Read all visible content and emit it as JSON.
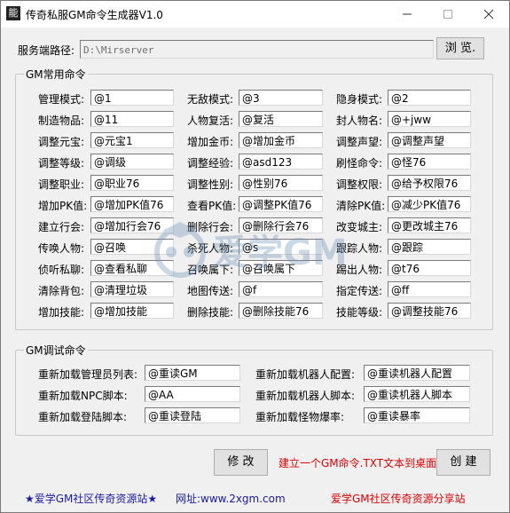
{
  "window": {
    "title": "传奇私服GM命令生成器V1.0",
    "app_icon_text": "能"
  },
  "server_path": {
    "label": "服务端路径:",
    "value": "D:\\Mirserver",
    "browse_label": "浏 览."
  },
  "common_group": {
    "title": "GM常用命令",
    "rows": [
      [
        {
          "label": "管理模式:",
          "value": "@1"
        },
        {
          "label": "无敌模式:",
          "value": "@3"
        },
        {
          "label": "隐身模式:",
          "value": "@2"
        }
      ],
      [
        {
          "label": "制造物品:",
          "value": "@11"
        },
        {
          "label": "人物复活:",
          "value": "@复活"
        },
        {
          "label": "封人物名:",
          "value": "@+jww"
        }
      ],
      [
        {
          "label": "调整元宝:",
          "value": "@元宝1"
        },
        {
          "label": "增加金币:",
          "value": "@增加金币"
        },
        {
          "label": "调整声望:",
          "value": "@调整声望"
        }
      ],
      [
        {
          "label": "调整等级:",
          "value": "@调级"
        },
        {
          "label": "调整经验:",
          "value": "@asd123"
        },
        {
          "label": "刷怪命令:",
          "value": "@怪76"
        }
      ],
      [
        {
          "label": "调整职业:",
          "value": "@职业76"
        },
        {
          "label": "调整性别:",
          "value": "@性别76"
        },
        {
          "label": "调整权限:",
          "value": "@给予权限76"
        }
      ],
      [
        {
          "label": "增加PK值:",
          "value": "@增加PK值76"
        },
        {
          "label": "查看PK值:",
          "value": "@调整PK值76"
        },
        {
          "label": "清除PK值:",
          "value": "@减少PK值76"
        }
      ],
      [
        {
          "label": "建立行会:",
          "value": "@增加行会76"
        },
        {
          "label": "删除行会:",
          "value": "@删除行会76"
        },
        {
          "label": "改变城主:",
          "value": "@更改城主76"
        }
      ],
      [
        {
          "label": "传唤人物:",
          "value": "@召唤"
        },
        {
          "label": "杀死人物:",
          "value": "@s"
        },
        {
          "label": "跟踪人物:",
          "value": "@跟踪"
        }
      ],
      [
        {
          "label": "侦听私聊:",
          "value": "@查看私聊"
        },
        {
          "label": "召唤属下:",
          "value": "@召唤属下"
        },
        {
          "label": "踢出人物:",
          "value": "@t76"
        }
      ],
      [
        {
          "label": "清除背包:",
          "value": "@清理垃圾"
        },
        {
          "label": "地图传送:",
          "value": "@f"
        },
        {
          "label": "指定传送:",
          "value": "@ff"
        }
      ],
      [
        {
          "label": "增加技能:",
          "value": "@增加技能"
        },
        {
          "label": "删除技能:",
          "value": "@删除技能76"
        },
        {
          "label": "技能等级:",
          "value": "@调整技能76"
        }
      ]
    ]
  },
  "debug_group": {
    "title": "GM调试命令",
    "rows": [
      [
        {
          "label": "重新加载管理员列表:",
          "value": "@重读GM"
        },
        {
          "label": "重新加载机器人配置:",
          "value": "@重读机器人配置"
        }
      ],
      [
        {
          "label": "重新加载NPC脚本:",
          "value": "@AA"
        },
        {
          "label": "重新加载机器人脚本:",
          "value": "@重读机器人脚本"
        }
      ],
      [
        {
          "label": "重新加载登陆脚本:",
          "value": "@重读登陆"
        },
        {
          "label": "重新加载怪物爆率:",
          "value": "@重读暴率"
        }
      ]
    ]
  },
  "actions": {
    "modify_label": "修 改",
    "hint": "建立一个GM命令.TXT文本到桌面",
    "create_label": "创 建"
  },
  "statusbar": {
    "left": "★爱学GM社区传奇资源站★",
    "url": "网址:www.2xgm.com",
    "right": "爱学GM社区传奇资源分享站"
  },
  "watermark": {
    "text": "爱学GM"
  },
  "colors": {
    "red": "#e00000",
    "blue": "#1a1aa6",
    "window_bg": "#f0f0f0"
  }
}
